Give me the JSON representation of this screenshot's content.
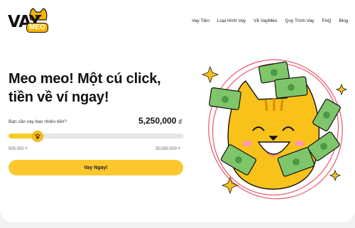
{
  "brand": {
    "vay": "VAY",
    "meo": "MEO"
  },
  "nav": [
    "Vay Tiền",
    "Loại Hình Vay",
    "Về VayMèo",
    "Quy Trình Vay",
    "FAQ",
    "Blog"
  ],
  "hero": {
    "headline": "Meo meo! Một cú click,\ntiền về ví ngay!",
    "question": "Bạn cần vay bao nhiêu tiền?",
    "amount": "5,250,000",
    "currency": "đ",
    "min_label": "500,000 ₫",
    "max_label": "30,000,000 ₫",
    "slider_fraction": 0.165,
    "cta_label": "Vay Ngay!"
  },
  "colors": {
    "accent": "#fdc82f",
    "track": "#e6e6e6",
    "money": "#7fc66b",
    "ring": "#e8556b"
  }
}
